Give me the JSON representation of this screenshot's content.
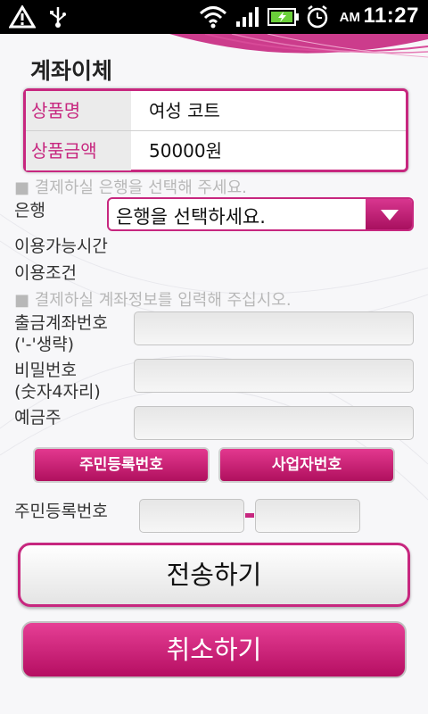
{
  "status_bar": {
    "ampm": "AM",
    "time": "11:27",
    "icons": [
      "alert-icon",
      "usb-icon",
      "wifi-icon",
      "signal-icon",
      "battery-charging-icon",
      "alarm-icon"
    ]
  },
  "page": {
    "title": "계좌이체"
  },
  "product": {
    "name_label": "상품명",
    "name_value": "여성 코트",
    "price_label": "상품금액",
    "price_value": "50000원"
  },
  "bank_section": {
    "hint": "■ 결제하실 은행을 선택해 주세요.",
    "bank_label": "은행",
    "bank_select_value": "은행을 선택하세요.",
    "available_time_label": "이용가능시간",
    "conditions_label": "이용조건"
  },
  "account_section": {
    "hint": "■ 결제하실 계좌정보를 입력해 주십시오.",
    "account_number_label_1": "출금계좌번호",
    "account_number_label_2": "('-'생략)",
    "password_label_1": "비밀번호",
    "password_label_2": "(숫자4자리)",
    "depositor_label": "예금주"
  },
  "id_section": {
    "resident_tab": "주민등록번호",
    "business_tab": "사업자번호",
    "resident_label": "주민등록번호"
  },
  "actions": {
    "submit": "전송하기",
    "cancel": "취소하기"
  },
  "colors": {
    "accent": "#c7277f",
    "accent_dark": "#a8105f",
    "hint_gray": "#b8b8b8"
  }
}
